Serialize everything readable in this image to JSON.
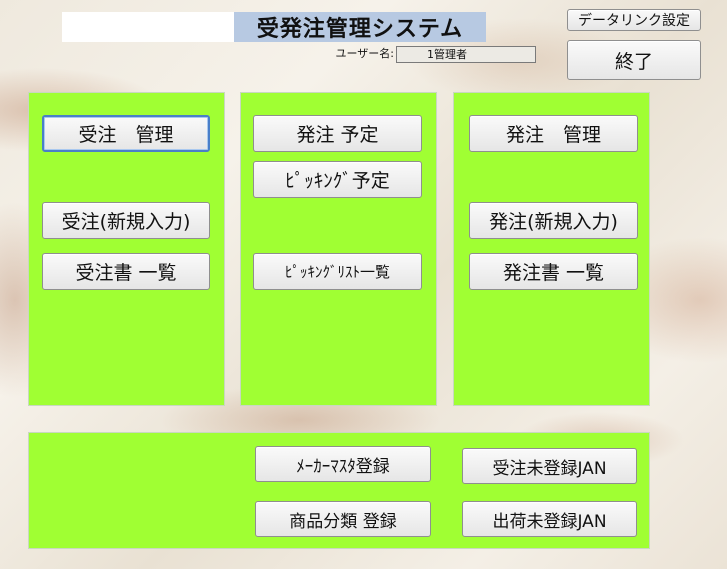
{
  "header": {
    "title": "受発注管理システム",
    "user_label": "ユーザー名:",
    "user_value": "1管理者",
    "data_link_label": "データリンク設定",
    "exit_label": "終了"
  },
  "panels": {
    "order_received": {
      "manage_label": "受注　管理",
      "new_entry_label": "受注(新規入力)",
      "list_label": "受注書 一覧"
    },
    "order_schedule": {
      "plan_label": "発注 予定",
      "picking_plan_label": "ﾋﾟｯｷﾝｸﾞ予定",
      "picking_list_label": "ﾋﾟｯｷﾝｸﾞﾘｽﾄ一覧"
    },
    "order_placed": {
      "manage_label": "発注　管理",
      "new_entry_label": "発注(新規入力)",
      "list_label": "発注書 一覧"
    }
  },
  "bottom": {
    "maker_master_label": "ﾒｰｶｰﾏｽﾀ登録",
    "product_category_label": "商品分類 登録",
    "order_unregistered_jan_label": "受注未登録JAN",
    "shipment_unregistered_jan_label": "出荷未登録JAN"
  }
}
